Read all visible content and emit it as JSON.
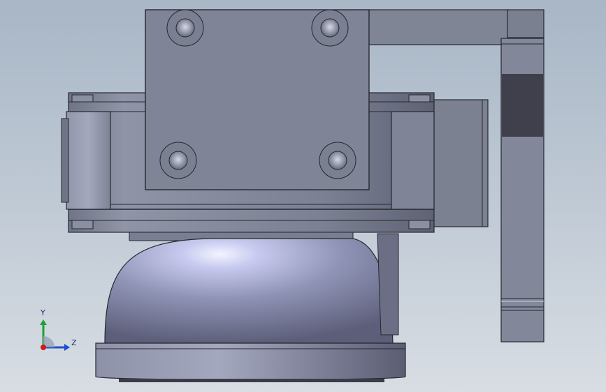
{
  "viewport": {
    "background_top": "#a8b6c6",
    "background_bottom": "#d8dde3"
  },
  "model": {
    "part_color": "#7c8192",
    "dome_highlight": "#e6e9ff",
    "dark_segment": "#3f404c"
  },
  "triad": {
    "y_label": "Y",
    "z_label": "Z",
    "y_color": "#1aa33a",
    "z_color": "#1f4fd0",
    "x_color": "#d01a1a"
  }
}
